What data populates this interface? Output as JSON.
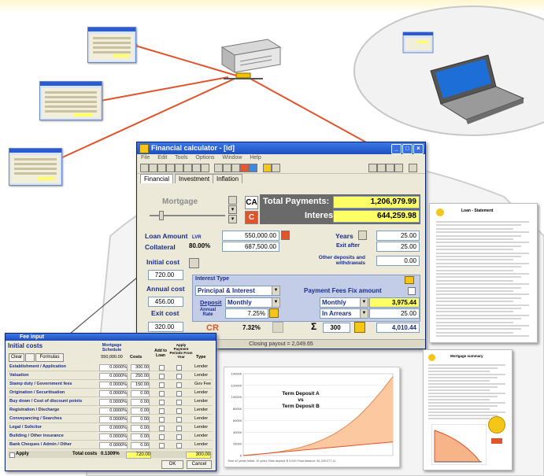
{
  "main_window": {
    "title": "Financial calculator - [id]",
    "menu": [
      "File",
      "Edit",
      "Tools",
      "Options",
      "Window",
      "Help"
    ],
    "tabs": [
      "Financial",
      "Investment",
      "Inflation"
    ],
    "mortgage_label": "Mortgage",
    "ca_button": "CA",
    "c_button": "C",
    "total_payments_label": "Total Payments:",
    "total_payments_value": "1,206,979.99",
    "interest_label": "Interest:",
    "interest_value": "644,259.98",
    "loan_amount_label": "Loan Amount",
    "lvr_label": "LVR",
    "loan_amount_value": "550,000.00",
    "collateral_label": "Collateral",
    "collateral_pct": "80.00%",
    "collateral_value": "687,500.00",
    "years_label": "Years",
    "years_value": "25.00",
    "exit_after_label": "Exit after",
    "exit_after_value": "25.00",
    "initial_cost_label": "Initial cost",
    "initial_cost_value": "720.00",
    "other_deposits_label": "Other deposits and withdrawals",
    "other_deposits_value": "0.00",
    "interest_type_label": "Interest Type",
    "interest_type_value": "Principal & Interest",
    "deposit_label": "Deposit",
    "deposit_freq": "Monthly",
    "annual_rate_label": "Annual Rate",
    "annual_rate_value": "7.25%",
    "annual_cost_label": "Annual cost",
    "annual_cost_value": "456.00",
    "exit_cost_label": "Exit cost",
    "exit_cost_value": "320.00",
    "payment_fees_label": "Payment Fees Fix amount",
    "payment_freq": "Monthly",
    "payment_value": "3,975.44",
    "in_arrears_label": "In Arrears",
    "in_arrears_value": "25.00",
    "cr_label": "CR",
    "cr_value": "7.32%",
    "sigma_value": "300",
    "final_value": "4,010.44",
    "status": "Closing payout = 2,049.65"
  },
  "costs_window": {
    "title": "Fee input",
    "header": "Initial costs",
    "col_mortgage": "Mortgage Schedule",
    "col_amount": "550,000.00",
    "col_costs": "Costs",
    "col_add_to_loan": "Add to Loan",
    "col_apply": "Apply Payment Periods From Year",
    "col_type": "Type",
    "btn_clear": "Clear",
    "btn_formulas": "Formulas",
    "rows": [
      {
        "name": "Establishment / Application",
        "pct": "0.0000%",
        "amt": "300.00",
        "type": "Lender"
      },
      {
        "name": "Valuation",
        "pct": "0.0000%",
        "amt": "250.00",
        "type": "Lender"
      },
      {
        "name": "Stamp duty / Government fees",
        "pct": "0.0000%",
        "amt": "150.00",
        "type": "Gov Fee"
      },
      {
        "name": "Origination / Securitisation",
        "pct": "0.0000%",
        "amt": "0.00",
        "type": "Lender"
      },
      {
        "name": "Buy down / Cost of discount points",
        "pct": "0.0000%",
        "amt": "0.00",
        "type": "Lender"
      },
      {
        "name": "Registration / Discharge",
        "pct": "0.0000%",
        "amt": "0.00",
        "type": "Lender"
      },
      {
        "name": "Conveyancing / Searches",
        "pct": "0.0000%",
        "amt": "0.00",
        "type": "Lender"
      },
      {
        "name": "Legal / Solicitor",
        "pct": "0.0000%",
        "amt": "0.00",
        "type": "Lender"
      },
      {
        "name": "Building / Other insurance",
        "pct": "0.0000%",
        "amt": "0.00",
        "type": "Lender"
      },
      {
        "name": "Bank Cheques / Admin / Other",
        "pct": "0.0000%",
        "amt": "0.00",
        "type": "Lender"
      }
    ],
    "apply_label": "Apply",
    "total_costs_label": "Total costs",
    "total_pct": "0.1309%",
    "total_amt": "720.00",
    "total_right": "300.00",
    "ok": "OK",
    "cancel": "Cancel"
  },
  "chart": {
    "annotation_line1": "Term Deposit A",
    "annotation_line2": "vs",
    "annotation_line3": "Term Deposit B",
    "yticks": [
      "140000",
      "120000",
      "100000",
      "80000",
      "60000",
      "40000",
      "20000",
      "0"
    ],
    "footer": "Time 40 years   Initial: 10 years   Total deposit: $ 9,000   Final balance: $1,200,077.11"
  },
  "chart_data": {
    "type": "area",
    "title": "",
    "ylim": [
      0,
      140000
    ],
    "series": [
      {
        "name": "Term Deposit A",
        "values": [
          0,
          1500,
          3500,
          6000,
          9500,
          14000,
          20000,
          28000,
          38000,
          51000,
          67000,
          87000,
          110000,
          135000
        ]
      },
      {
        "name": "Term Deposit B",
        "values": [
          0,
          1800,
          3600,
          5400,
          7200,
          9000,
          10800,
          12600,
          14400,
          16200,
          18000,
          19800,
          21600,
          23400
        ]
      }
    ]
  },
  "report_right": {
    "title": "Loan - Statement"
  },
  "report_bottom": {
    "title": "Mortgage summary"
  },
  "colors": {
    "titlebar": "#1d4fc0",
    "highlight": "#ffff66",
    "network_line": "#e0542c",
    "dark_red": "#c0301c"
  }
}
